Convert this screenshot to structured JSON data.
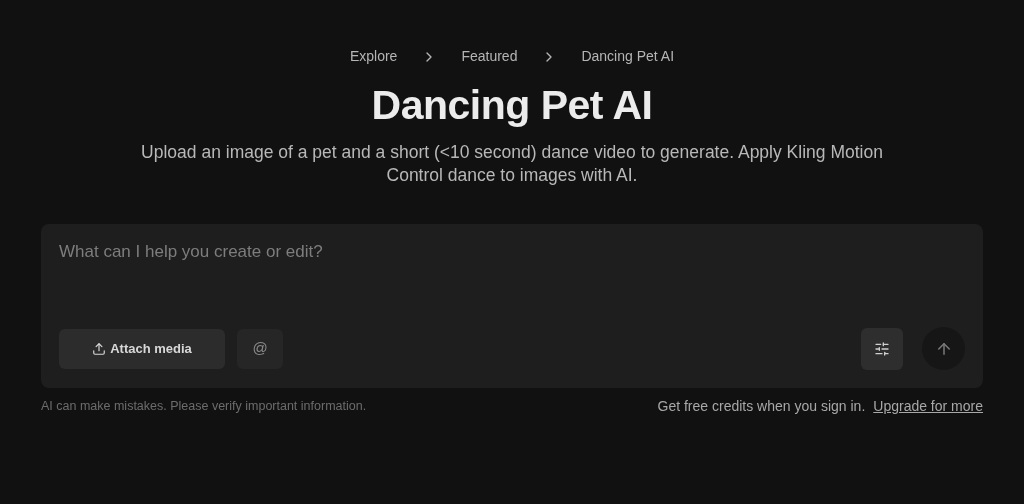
{
  "breadcrumb": [
    {
      "label": "Explore"
    },
    {
      "label": "Featured"
    },
    {
      "label": "Dancing Pet AI"
    }
  ],
  "title": "Dancing Pet AI",
  "subtitle": "Upload an image of a pet and a short (<10 second) dance video to generate. Apply Kling Motion Control dance to images with AI.",
  "prompt": {
    "placeholder": "What can I help you create or edit?",
    "attach_label": "Attach media",
    "mention_label": "@"
  },
  "footer": {
    "disclaimer": "AI can make mistakes. Please verify important information.",
    "credits": "Get free credits when you sign in.",
    "upgrade_link": "Upgrade for more"
  }
}
